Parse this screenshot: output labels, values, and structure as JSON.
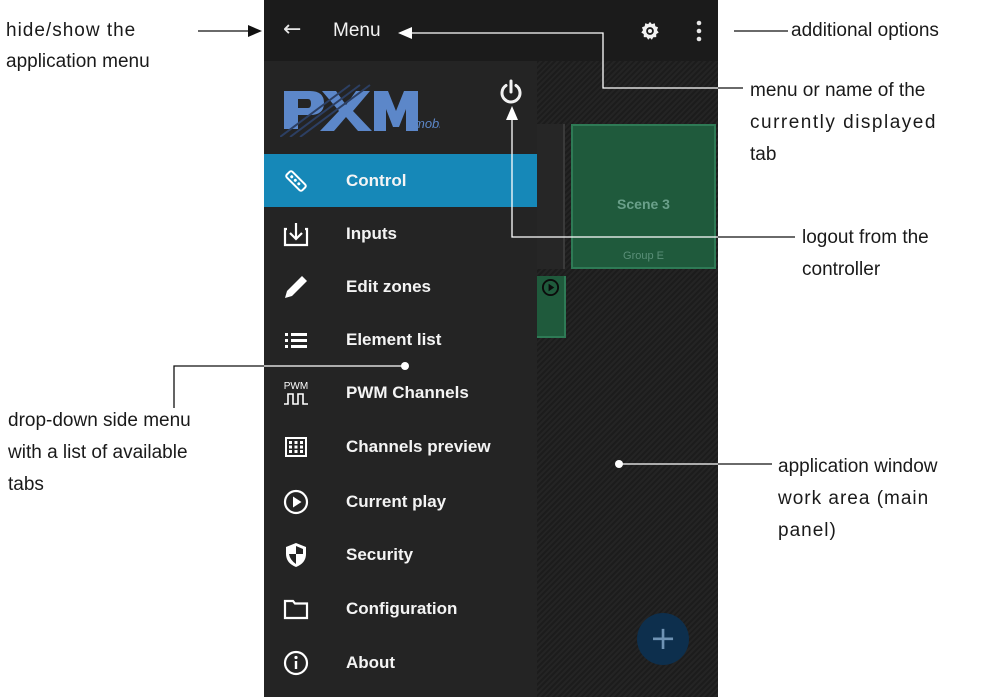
{
  "annotations": {
    "hide_show": [
      "hide/show the",
      "application menu"
    ],
    "additional_options": "additional options",
    "menu_name": [
      "menu or name of the",
      "currently displayed",
      "tab"
    ],
    "logout": [
      "logout from the",
      "controller"
    ],
    "dropdown": [
      "drop-down side menu",
      "with a list of available",
      "tabs"
    ],
    "work_area": [
      "application window",
      "work area (main",
      "panel)"
    ]
  },
  "app": {
    "title": "Menu",
    "icons": {
      "back": "back-arrow-icon",
      "settings": "gear-icon",
      "more": "more-vertical-icon",
      "power": "power-icon"
    },
    "logo": "PXM mobile"
  },
  "drawer": {
    "items": [
      {
        "label": "Control",
        "icon": "remote-control-icon",
        "active": true
      },
      {
        "label": "Inputs",
        "icon": "input-download-icon"
      },
      {
        "label": "Edit zones",
        "icon": "pencil-icon"
      },
      {
        "label": "Element list",
        "icon": "list-icon"
      },
      {
        "label": "PWM Channels",
        "icon": "pwm-signal-icon",
        "icon_text": "PWM"
      },
      {
        "label": "Channels preview",
        "icon": "grid-preview-icon"
      },
      {
        "label": "Current play",
        "icon": "play-circle-icon"
      },
      {
        "label": "Security",
        "icon": "shield-icon"
      },
      {
        "label": "Configuration",
        "icon": "folder-icon"
      },
      {
        "label": "About",
        "icon": "info-icon"
      }
    ]
  },
  "main_panel": {
    "scene_tile": {
      "title": "Scene 3",
      "group": "Group E"
    },
    "fab_label": "+"
  },
  "colors": {
    "accent": "#1688b8",
    "scene": "#1f5a3c",
    "drawer": "#242424",
    "topbar": "#1b1b1b"
  }
}
